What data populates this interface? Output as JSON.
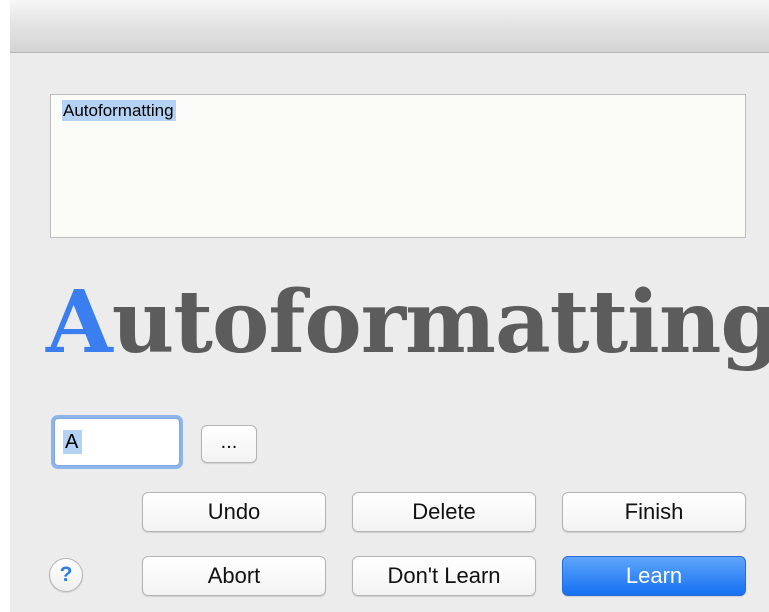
{
  "text_area": {
    "value": "Autoformatting"
  },
  "preview": {
    "first_letter": "A",
    "rest": "utoformatting"
  },
  "char_field": {
    "value": "A"
  },
  "buttons": {
    "ellipsis": "...",
    "undo": "Undo",
    "delete": "Delete",
    "finish": "Finish",
    "abort": "Abort",
    "dont_learn": "Don't Learn",
    "learn": "Learn"
  },
  "help": {
    "glyph": "?",
    "icon": "help-icon"
  },
  "colors": {
    "accent": "#1670f2",
    "preview_first_letter": "#3a7ef0",
    "preview_text": "#5c5c5c",
    "selection": "#b4d3f4"
  }
}
